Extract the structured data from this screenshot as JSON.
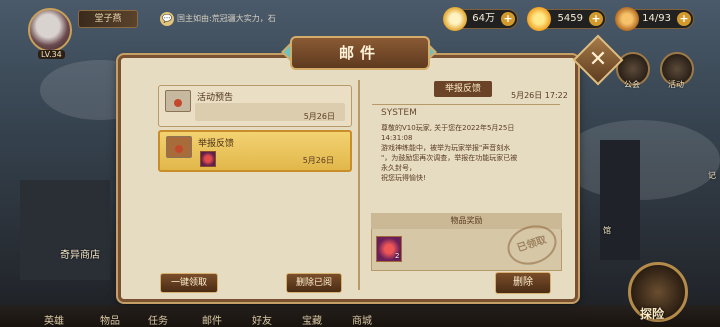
{
  "hud": {
    "level": "LV.34",
    "player_name": "堂子燕",
    "chat_text": "国主如由:荒冠疆大实力，石",
    "gold": "64万",
    "diamonds": "5459",
    "stamina": "14/93"
  },
  "side": {
    "guild_label": "公会",
    "event_label": "活动",
    "museum_label": "馆",
    "partial_label": "记"
  },
  "store_label": "奇异商店",
  "mail": {
    "title": "邮件",
    "items": [
      {
        "title": "活动预告",
        "date": "5月26日"
      },
      {
        "title": "举报反馈",
        "date": "5月26日"
      }
    ],
    "claim_all_label": "一键领取",
    "delete_read_label": "删除已阅",
    "detail": {
      "tag": "举报反馈",
      "date": "5月26日 17:22",
      "sender": "SYSTEM",
      "body": "尊敬的V10玩家, 关于您在2022年5月25日\n14:31:08\n游戏神练能中，被举为玩家举报\"声音刻水\n\"，为鼓励您再次调查，举报在功能玩家已被\n永久封号，\n祝您玩得愉快!",
      "reward_title": "物品奖励",
      "reward_qty": "2",
      "stamp": "已领取",
      "delete_label": "删除"
    }
  },
  "nav": [
    "英雄",
    "物品",
    "任务",
    "邮件",
    "好友",
    "宝藏",
    "商城"
  ],
  "explore_label": "探险"
}
